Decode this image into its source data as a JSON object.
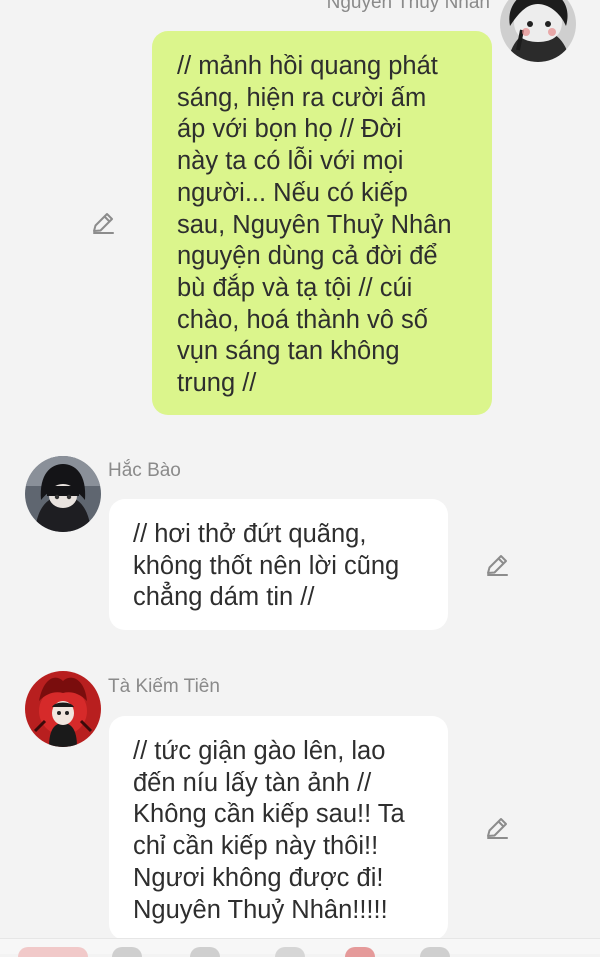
{
  "messages": [
    {
      "direction": "outgoing",
      "sender": "Nguyên Thuỷ Nhân",
      "text": "// mảnh hồi quang phát\nsáng, hiện ra cười ấm\náp với bọn họ // Đời\nnày ta có lỗi với mọi\nngười... Nếu có kiếp\nsau, Nguyên Thuỷ Nhân\nnguyện dùng cả đời để\nbù đắp và tạ tội // cúi\nchào, hoá thành vô số\nvụn sáng tan không\ntrung //",
      "avatar_icon": "avatar-nguyen-thuy-nhan",
      "edit_icon": "pencil-icon"
    },
    {
      "direction": "incoming",
      "sender": "Hắc Bào",
      "text": "// hơi thở đứt quãng,\nkhông thốt nên lời cũng\nchẳng dám tin //",
      "avatar_icon": "avatar-hac-bao",
      "edit_icon": "pencil-icon"
    },
    {
      "direction": "incoming",
      "sender": "Tà Kiếm Tiên",
      "text": "// tức giận gào lên, lao\nđến níu lấy tàn ảnh //\nKhông cần kiếp sau!! Ta\nchỉ cần kiếp này thôi!!\nNgươi không được đi!\nNguyên Thuỷ Nhân!!!!!",
      "avatar_icon": "avatar-ta-kiem-tien",
      "edit_icon": "pencil-icon"
    }
  ],
  "colors": {
    "background": "#f3f3f3",
    "outgoing_bubble": "#dbf58c",
    "incoming_bubble": "#ffffff",
    "text": "#2e2e2e",
    "sender_name": "#8a8a8a",
    "edit_icon": "#8c8c8c"
  }
}
